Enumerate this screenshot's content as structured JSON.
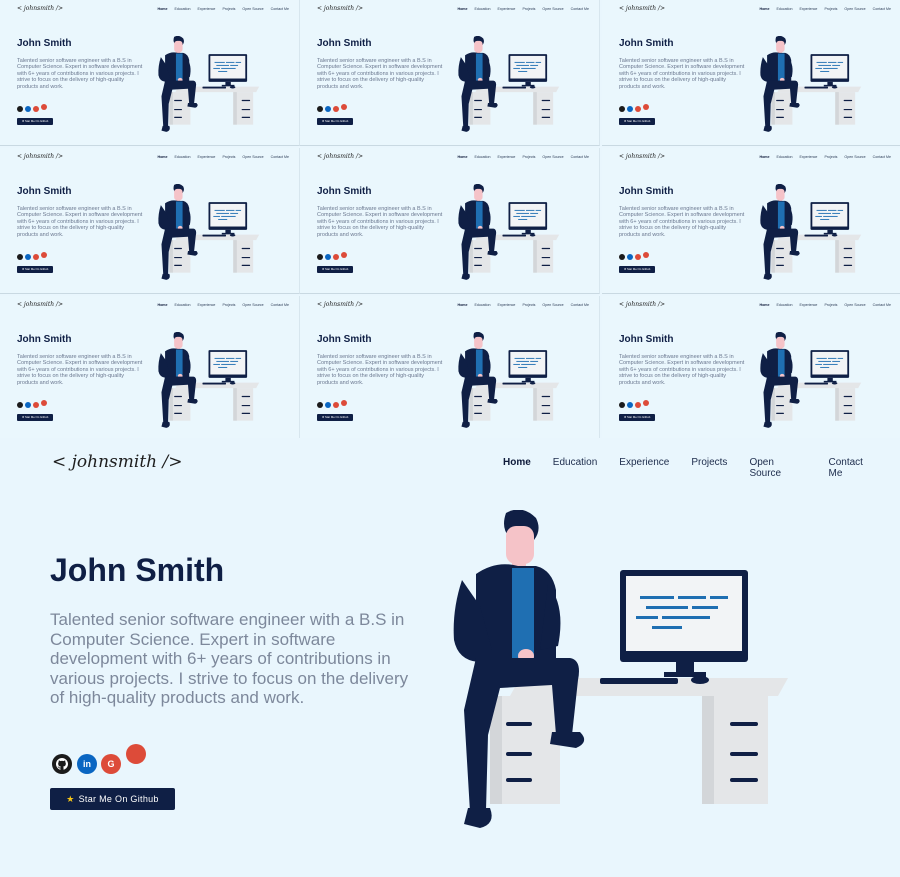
{
  "logo": "< johnsmith />",
  "nav": {
    "items": [
      "Home",
      "Education",
      "Experience",
      "Projects",
      "Open Source",
      "Contact Me"
    ],
    "active": "Home"
  },
  "hero": {
    "name": "John Smith",
    "bio": "Talented senior software engineer with a B.S in Computer Science. Expert in software development with 6+ years of contributions in various projects. I strive to focus on the delivery of high-quality products and work.",
    "github_button": "Star Me On Github",
    "star_glyph": "★"
  },
  "socials": [
    {
      "name": "github-icon",
      "glyph": "",
      "color": "#1b1b1b"
    },
    {
      "name": "linkedin-icon",
      "glyph": "in",
      "color": "#0a66c2"
    },
    {
      "name": "google-icon",
      "glyph": "G",
      "color": "#dd4b39"
    },
    {
      "name": "extra-social-icon",
      "glyph": "",
      "color": "#dd4b39"
    }
  ],
  "thumbnail_grid": {
    "rows": 3,
    "columns": 3
  },
  "colors": {
    "background": "#e9f6fd",
    "navy": "#0f1f45",
    "muted_text": "#7d889b",
    "accent_blue": "#1f6fb2",
    "desk": "#e4e6e8"
  }
}
